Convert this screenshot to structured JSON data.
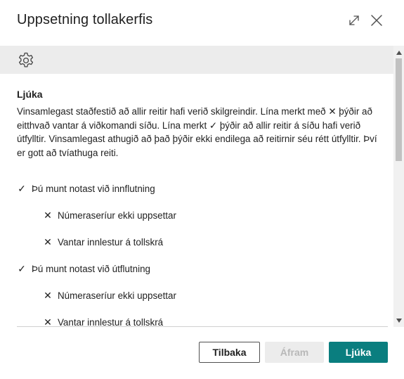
{
  "dialog": {
    "title": "Uppsetning tollakerfis",
    "icons": {
      "expand": "expand-icon",
      "close": "close-icon",
      "settings": "gear-icon"
    }
  },
  "content": {
    "section_title": "Ljúka",
    "description": "Vinsamlegast staðfestið að allir reitir hafi verið skilgreindir. Lína merkt með ✕ þýðir að eitthvað vantar á viðkomandi síðu. Lína merkt ✓ þýðir að allir reitir á síðu hafi verið útfylltir. Vinsamlegast athugið að það þýðir ekki endilega að reitirnir séu rétt útfylltir. Því er gott að tvíathuga reiti.",
    "checklist": [
      {
        "mark": "✓",
        "label": "Þú munt notast við innflutning",
        "level": 0
      },
      {
        "mark": "✕",
        "label": "Númeraseríur ekki uppsettar",
        "level": 1
      },
      {
        "mark": "✕",
        "label": "Vantar innlestur á tollskrá",
        "level": 1
      },
      {
        "mark": "✓",
        "label": "Þú munt notast við útflutning",
        "level": 0
      },
      {
        "mark": "✕",
        "label": "Númeraseríur ekki uppsettar",
        "level": 1
      },
      {
        "mark": "✕",
        "label": "Vantar innlestur á tollskrá",
        "level": 1
      }
    ]
  },
  "footer": {
    "back_label": "Tilbaka",
    "next_label": "Áfram",
    "finish_label": "Ljúka"
  },
  "colors": {
    "accent": "#0a7e7f",
    "toolbar_bg": "#ececec",
    "disabled_text": "#b8b8b8"
  }
}
